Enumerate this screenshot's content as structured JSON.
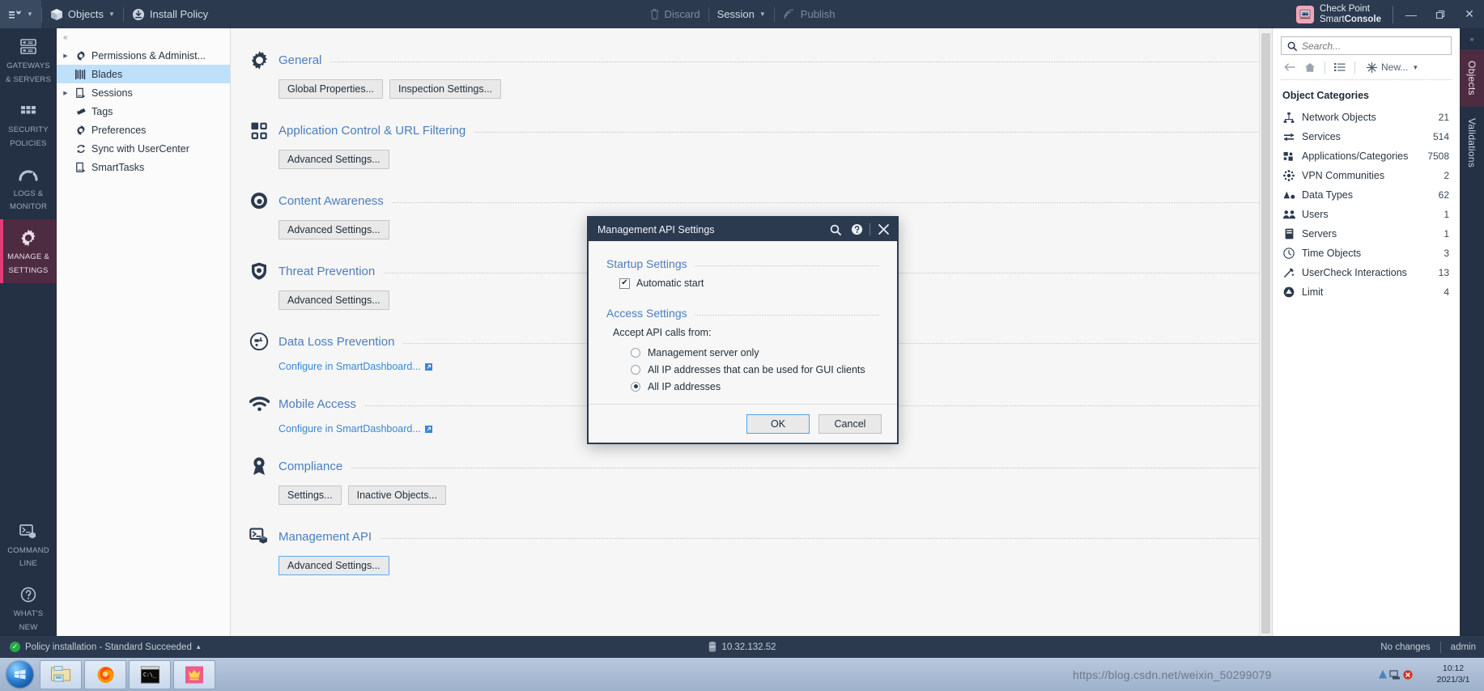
{
  "topbar": {
    "menu_icon": "menu-icon",
    "objects_label": "Objects",
    "install_policy_label": "Install Policy",
    "discard_label": "Discard",
    "session_label": "Session",
    "publish_label": "Publish",
    "brand_line1": "Check Point",
    "brand_line2_light": "Smart",
    "brand_line2_bold": "Console",
    "minimize_glyph": "—",
    "restore_glyph": "❐",
    "close_glyph": "✕"
  },
  "rail": {
    "items": [
      {
        "icon": "servers-icon",
        "label": "GATEWAYS\n& SERVERS",
        "line1": "GATEWAYS",
        "line2": "& SERVERS",
        "active": false
      },
      {
        "icon": "grid-icon",
        "label": "SECURITY POLICIES",
        "line1": "SECURITY",
        "line2": "POLICIES",
        "active": false
      },
      {
        "icon": "gauge-icon",
        "label": "LOGS & MONITOR",
        "line1": "LOGS &",
        "line2": "MONITOR",
        "active": false
      },
      {
        "icon": "gear-icon",
        "label": "MANAGE & SETTINGS",
        "line1": "MANAGE &",
        "line2": "SETTINGS",
        "active": true
      }
    ],
    "bottom_items": [
      {
        "icon": "terminal-icon",
        "line1": "COMMAND",
        "line2": "LINE"
      },
      {
        "icon": "question-circle-icon",
        "line1": "WHAT'S",
        "line2": "NEW"
      }
    ]
  },
  "nav": {
    "collapse_glyph": "«",
    "items": [
      {
        "label": "Permissions & Administ...",
        "icon": "gear-icon",
        "expandable": true,
        "selected": false
      },
      {
        "label": "Blades",
        "icon": "blades-icon",
        "expandable": false,
        "selected": true
      },
      {
        "label": "Sessions",
        "icon": "sessions-icon",
        "expandable": true,
        "selected": false
      },
      {
        "label": "Tags",
        "icon": "tag-icon",
        "expandable": false,
        "selected": false
      },
      {
        "label": "Preferences",
        "icon": "gear-icon",
        "expandable": false,
        "selected": false
      },
      {
        "label": "Sync with UserCenter",
        "icon": "sync-icon",
        "expandable": false,
        "selected": false
      },
      {
        "label": "SmartTasks",
        "icon": "smarttasks-icon",
        "expandable": false,
        "selected": false
      }
    ]
  },
  "main": {
    "sections": [
      {
        "icon": "gear-icon",
        "title": "General",
        "controls": [
          {
            "kind": "button",
            "label": "Global Properties...",
            "focused": false
          },
          {
            "kind": "button",
            "label": "Inspection Settings...",
            "focused": false
          }
        ]
      },
      {
        "icon": "app-control-icon",
        "title": "Application Control & URL Filtering",
        "controls": [
          {
            "kind": "button",
            "label": "Advanced Settings...",
            "focused": false
          }
        ]
      },
      {
        "icon": "content-awareness-icon",
        "title": "Content Awareness",
        "controls": [
          {
            "kind": "button",
            "label": "Advanced Settings...",
            "focused": false
          }
        ]
      },
      {
        "icon": "shield-icon",
        "title": "Threat Prevention",
        "controls": [
          {
            "kind": "button",
            "label": "Advanced Settings...",
            "focused": false
          }
        ]
      },
      {
        "icon": "dlp-icon",
        "title": "Data Loss Prevention",
        "controls": [
          {
            "kind": "link",
            "label": "Configure in SmartDashboard..."
          }
        ]
      },
      {
        "icon": "mobile-access-icon",
        "title": "Mobile Access",
        "controls": [
          {
            "kind": "link",
            "label": "Configure in SmartDashboard..."
          }
        ]
      },
      {
        "icon": "compliance-icon",
        "title": "Compliance",
        "controls": [
          {
            "kind": "button",
            "label": "Settings...",
            "focused": false
          },
          {
            "kind": "button",
            "label": "Inactive Objects...",
            "focused": false
          }
        ]
      },
      {
        "icon": "management-api-icon",
        "title": "Management API",
        "controls": [
          {
            "kind": "button",
            "label": "Advanced Settings...",
            "focused": true
          }
        ]
      }
    ]
  },
  "rightpane": {
    "search_placeholder": "Search...",
    "back_icon": "back-arrow-icon",
    "home_icon": "home-icon",
    "list_icon": "list-icon",
    "new_label": "New...",
    "title": "Object Categories",
    "categories": [
      {
        "icon": "network-objects-icon",
        "name": "Network Objects",
        "count": "21"
      },
      {
        "icon": "services-icon",
        "name": "Services",
        "count": "514"
      },
      {
        "icon": "applications-icon",
        "name": "Applications/Categories",
        "count": "7508"
      },
      {
        "icon": "vpn-icon",
        "name": "VPN Communities",
        "count": "2"
      },
      {
        "icon": "data-types-icon",
        "name": "Data Types",
        "count": "62"
      },
      {
        "icon": "users-icon",
        "name": "Users",
        "count": "1"
      },
      {
        "icon": "servers-icon",
        "name": "Servers",
        "count": "1"
      },
      {
        "icon": "clock-icon",
        "name": "Time Objects",
        "count": "3"
      },
      {
        "icon": "usercheck-icon",
        "name": "UserCheck Interactions",
        "count": "13"
      },
      {
        "icon": "limit-icon",
        "name": "Limit",
        "count": "4"
      }
    ]
  },
  "tabstrip": {
    "collapse_glyph": "»",
    "tabs": [
      {
        "label": "Objects",
        "active": true
      },
      {
        "label": "Validations",
        "active": false
      }
    ]
  },
  "dialog": {
    "title": "Management API Settings",
    "search_icon": "search-icon",
    "help_icon": "help-icon",
    "close_icon": "close-icon",
    "startup_group": "Startup Settings",
    "automatic_start_label": "Automatic start",
    "automatic_start_checked": true,
    "check_glyph": "✔",
    "access_group": "Access Settings",
    "accept_label": "Accept API calls from:",
    "options": [
      {
        "label": "Management server only",
        "selected": false
      },
      {
        "label": "All IP addresses that can be used for GUI clients",
        "selected": false
      },
      {
        "label": "All IP addresses",
        "selected": true
      }
    ],
    "ok_label": "OK",
    "cancel_label": "Cancel"
  },
  "statusbar": {
    "policy_status": "Policy installation - Standard Succeeded",
    "policy_caret": "▴",
    "server_ip": "10.32.132.52",
    "changes": "No changes",
    "user": "admin"
  },
  "taskbar": {
    "apps": [
      {
        "icon": "explorer-icon"
      },
      {
        "icon": "firefox-icon"
      },
      {
        "icon": "cmd-icon"
      },
      {
        "icon": "smartconsole-icon"
      }
    ],
    "clock_time": "10:12",
    "clock_date": "2021/3/1"
  },
  "watermark": "https://blog.csdn.net/weixin_50299079",
  "colors": {
    "chrome_dark": "#2b3a4f",
    "rail_dark": "#243044",
    "accent_magenta": "#e23c74",
    "link_blue": "#4a7ebb",
    "selection_blue": "#bfe0fb",
    "success_green": "#27a844"
  }
}
